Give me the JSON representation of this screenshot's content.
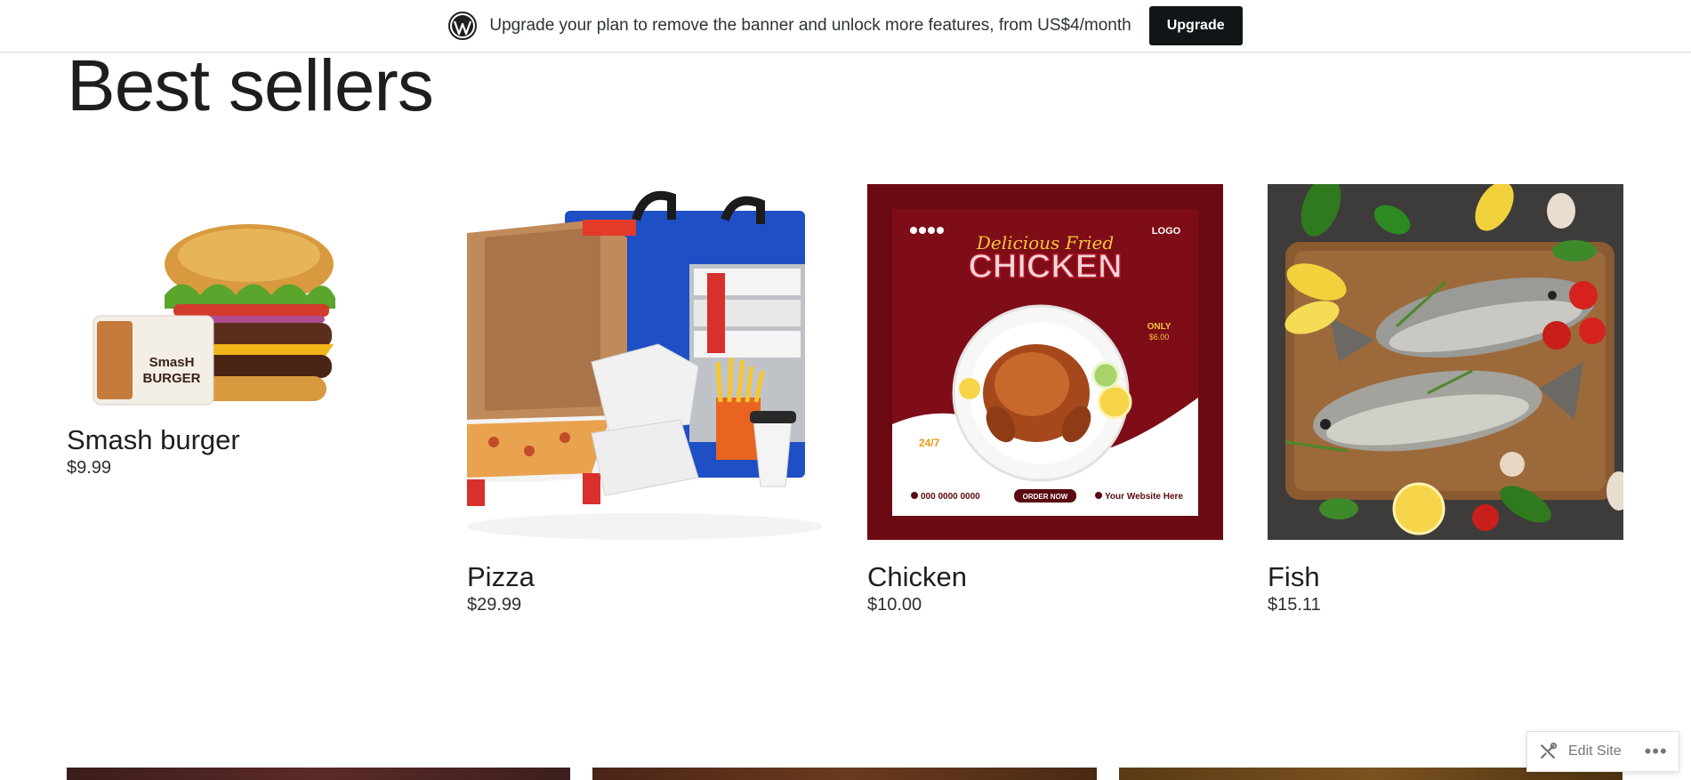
{
  "banner": {
    "text": "Upgrade your plan to remove the banner and unlock more features, from US$4/month",
    "button_label": "Upgrade"
  },
  "page": {
    "title": "Best sellers"
  },
  "products": [
    {
      "name": "Smash burger",
      "price": "$9.99",
      "card_brand_top": "SmasH",
      "card_brand_bottom": "BURGER"
    },
    {
      "name": "Pizza",
      "price": "$29.99"
    },
    {
      "name": "Chicken",
      "price": "$10.00",
      "flyer_script": "Delicious Fried",
      "flyer_title": "CHICKEN",
      "flyer_logo": "LOGO",
      "flyer_only": "ONLY",
      "flyer_price": "$6.00",
      "flyer_247": "24/7",
      "flyer_phone": "000 0000 0000",
      "flyer_order": "ORDER NOW",
      "flyer_site": "Your Website Here"
    },
    {
      "name": "Fish",
      "price": "$15.11"
    }
  ],
  "admin": {
    "edit_label": "Edit Site",
    "more_label": "•••"
  },
  "colors": {
    "upgrade_bg": "#101517",
    "chicken_bg": "#6b0a12"
  }
}
